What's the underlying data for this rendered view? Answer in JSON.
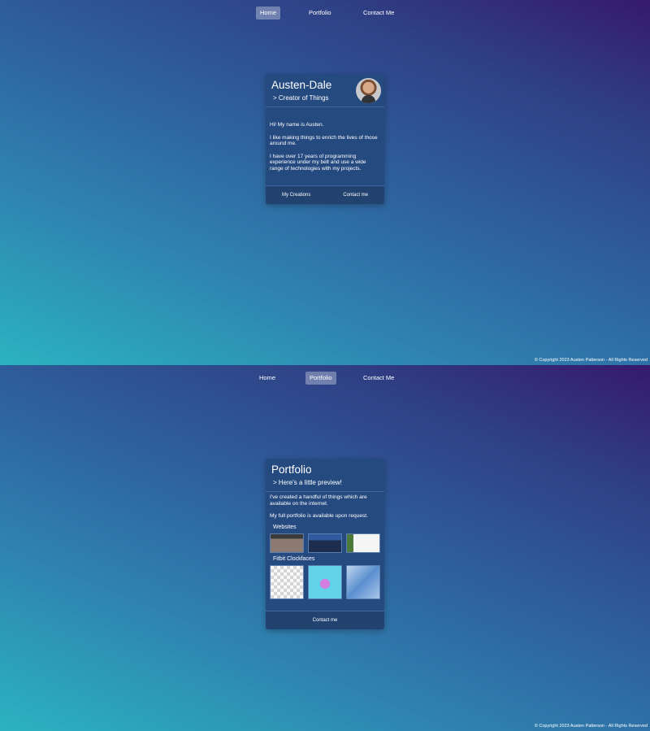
{
  "nav": {
    "home": "Home",
    "portfolio": "Portfolio",
    "contact": "Contact Me"
  },
  "home_card": {
    "title": "Austen-Dale",
    "subtitle": "> Creator of Things",
    "paragraphs": [
      "Hi! My name is Austen.",
      "I like making things to enrich the lives of those around me.",
      "I have over 17 years of programming experience under my belt and use a wide range of technologies with my projects."
    ],
    "actions": {
      "creations": "My Creations",
      "contact": "Contact me"
    }
  },
  "portfolio_card": {
    "title": "Portfolio",
    "subtitle": "> Here's a little preview!",
    "paragraphs": [
      "I've created a handful of things which are available on the internet.",
      "My full portfolio is available upon request."
    ],
    "websites_label": "Websites",
    "clockfaces_label": "Fitbit Clockfaces",
    "contact": "Contact me"
  },
  "copyright": "© Copyright 2023 Austen Patterson - All Rights Reserved"
}
